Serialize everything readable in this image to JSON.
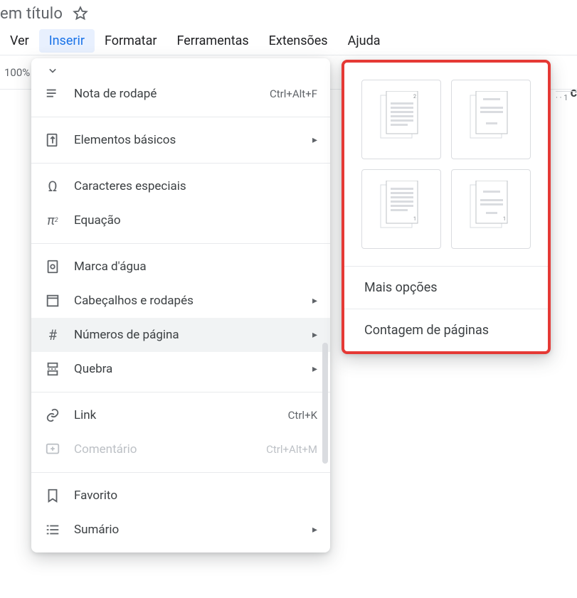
{
  "title_fragment": "em título",
  "menubar": {
    "ver": "Ver",
    "inserir": "Inserir",
    "formatar": "Formatar",
    "ferramentas": "Ferramentas",
    "extensoes": "Extensões",
    "ajuda": "Ajuda"
  },
  "zoom_value": "100%",
  "ruler_mark": "1",
  "menu": {
    "cut_off_top": "",
    "nota_rodape": "Nota de rodapé",
    "nota_rodape_accel": "Ctrl+Alt+F",
    "elementos_basicos": "Elementos básicos",
    "caracteres_especiais": "Caracteres especiais",
    "equacao": "Equação",
    "marca_dagua": "Marca d'água",
    "cabecalhos_rodapes": "Cabeçalhos e rodapés",
    "numeros_pagina": "Números de página",
    "quebra": "Quebra",
    "link": "Link",
    "link_accel": "Ctrl+K",
    "comentario": "Comentário",
    "comentario_accel": "Ctrl+Alt+M",
    "favorito": "Favorito",
    "sumario": "Sumário"
  },
  "submenu": {
    "mais_opcoes": "Mais opções",
    "contagem_paginas": "Contagem de páginas"
  }
}
